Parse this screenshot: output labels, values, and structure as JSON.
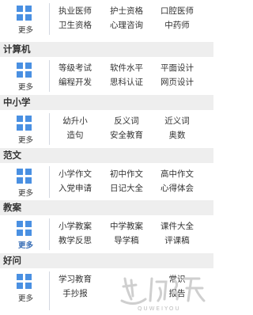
{
  "sections": [
    {
      "title": "",
      "more": "更多",
      "more_blue": false,
      "links": [
        [
          "执业医师",
          "护士资格",
          "口腔医师"
        ],
        [
          "卫生资格",
          "心理咨询",
          "中药师"
        ]
      ]
    },
    {
      "title": "计算机",
      "more": "更多",
      "more_blue": false,
      "links": [
        [
          "等级考试",
          "软件水平",
          "平面设计"
        ],
        [
          "编程开发",
          "思科认证",
          "网页设计"
        ]
      ]
    },
    {
      "title": "中小学",
      "more": "更多",
      "more_blue": false,
      "links": [
        [
          "幼升小",
          "反义词",
          "近义词"
        ],
        [
          "造句",
          "安全教育",
          "奥数"
        ]
      ]
    },
    {
      "title": "范文",
      "more": "更多",
      "more_blue": false,
      "links": [
        [
          "小学作文",
          "初中作文",
          "高中作文"
        ],
        [
          "入党申请",
          "日记大全",
          "心得体会"
        ]
      ]
    },
    {
      "title": "教案",
      "more": "更多",
      "more_blue": true,
      "links": [
        [
          "小学教案",
          "中学教案",
          "课件大全"
        ],
        [
          "教学反思",
          "导学稿",
          "评课稿"
        ]
      ]
    },
    {
      "title": "好问",
      "more": "更多",
      "more_blue": false,
      "links": [
        [
          "学习教育",
          "",
          "常识"
        ],
        [
          "手抄报",
          "",
          "报告"
        ]
      ]
    }
  ],
  "watermark": {
    "logo": "趣微游",
    "sub": "QUWEIYOU"
  },
  "colors": {
    "icon": "#4a90e2",
    "more_blue": "#3a6fb6",
    "stripe": "#eeeeee"
  }
}
